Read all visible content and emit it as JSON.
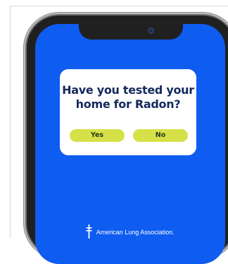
{
  "survey": {
    "question": "Have you tested your home for Radon?",
    "yes_label": "Yes",
    "no_label": "No"
  },
  "brand": {
    "name": "American Lung Association.",
    "logo_icon": "double-barred-cross-icon"
  },
  "colors": {
    "screen_blue": "#0e5cf0",
    "button_lime": "#d6e14a",
    "question_navy": "#152a5c"
  }
}
